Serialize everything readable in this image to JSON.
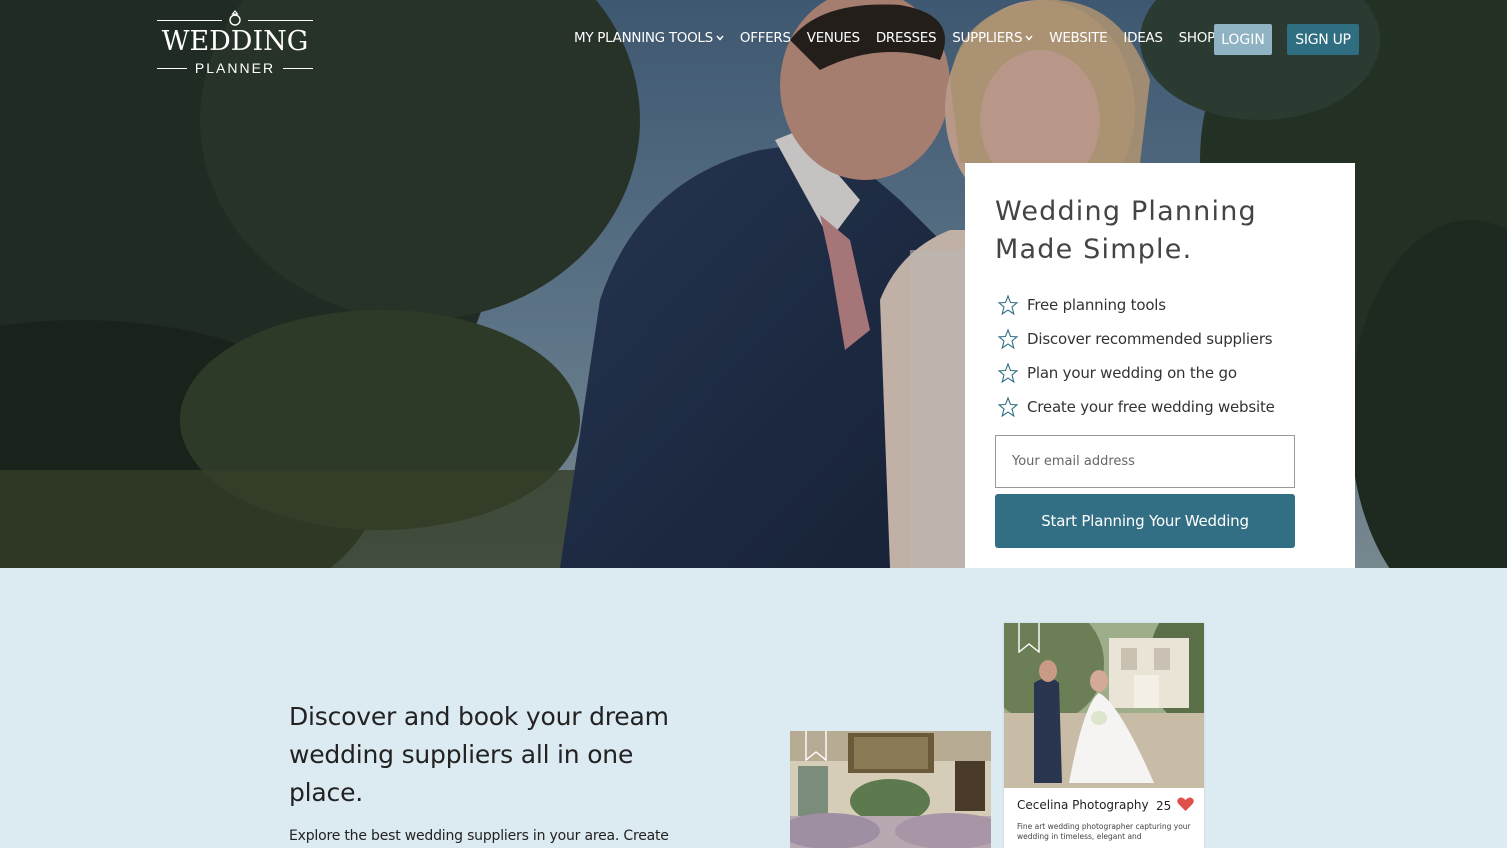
{
  "brand": {
    "logo_main": "WEDDING",
    "logo_sub": "PLANNER"
  },
  "nav": {
    "items": [
      {
        "label": "MY PLANNING TOOLS",
        "dropdown": true
      },
      {
        "label": "OFFERS",
        "dropdown": false
      },
      {
        "label": "VENUES",
        "dropdown": false
      },
      {
        "label": "DRESSES",
        "dropdown": false
      },
      {
        "label": "SUPPLIERS",
        "dropdown": true
      },
      {
        "label": "WEBSITE",
        "dropdown": false
      },
      {
        "label": "IDEAS",
        "dropdown": false
      },
      {
        "label": "SHOP",
        "dropdown": false
      }
    ],
    "login_label": "LOGIN",
    "signup_label": "SIGN UP"
  },
  "hero_card": {
    "title": "Wedding Planning Made Simple.",
    "features": [
      "Free planning tools",
      "Discover recommended suppliers",
      "Plan your wedding on the go",
      "Create your free wedding website"
    ],
    "email_placeholder": "Your email address",
    "cta_label": "Start Planning Your Wedding"
  },
  "suppliers_section": {
    "title": "Discover and book your dream wedding suppliers all in one place.",
    "text": "Explore the best wedding suppliers in your area. Create"
  },
  "supplier_card": {
    "name": "Cecelina Photography",
    "likes": "25",
    "description": "Fine art wedding photographer capturing your wedding in timeless, elegant and"
  },
  "colors": {
    "primary": "#336f84",
    "login_bg": "#8fb3c3",
    "section_bg": "#dceaf2",
    "heart": "#e0504a"
  }
}
